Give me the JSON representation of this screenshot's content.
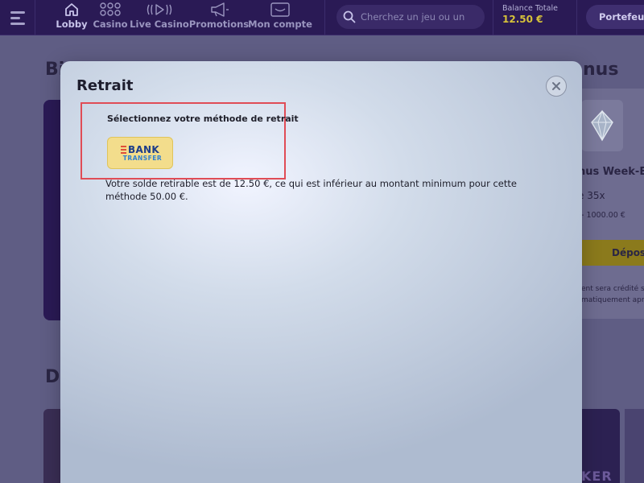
{
  "nav": {
    "items": [
      {
        "label": "Lobby",
        "icon": "home-icon"
      },
      {
        "label": "Casino",
        "icon": "grid-icon"
      },
      {
        "label": "Live Casino",
        "icon": "play-icon"
      },
      {
        "label": "Promotions",
        "icon": "megaphone-icon"
      },
      {
        "label": "Mon compte",
        "icon": "account-icon"
      }
    ],
    "search_placeholder": "Cherchez un jeu ou un",
    "balance_label": "Balance Totale",
    "balance_value": "12.50 €",
    "wallet_label": "Portefeuille"
  },
  "background": {
    "heading_top_left": "Bi",
    "heading_top_right": "nus",
    "heading_bottom_left": "D",
    "bonus_title": "nus Week-E",
    "wager": "e 35x",
    "range": "- 1000.00 €",
    "deposit_label": "Dépose",
    "note_line1": "ent sera crédité s",
    "note_line2": "matiquement apre",
    "thumb_text": "KER"
  },
  "modal": {
    "title": "Retrait",
    "method_label": "Sélectionnez votre méthode de retrait",
    "bank_word": "BANK",
    "bank_sub": "TRANSFER",
    "message": "Votre solde retirable est de 12.50 €, ce qui est inférieur au montant minimum pour cette méthode 50.00 €."
  },
  "colors": {
    "nav_bg": "#2a1a55",
    "balance_accent": "#d6c23a",
    "highlight_border": "#e04c56",
    "bank_button_bg": "#f3dd8c"
  }
}
